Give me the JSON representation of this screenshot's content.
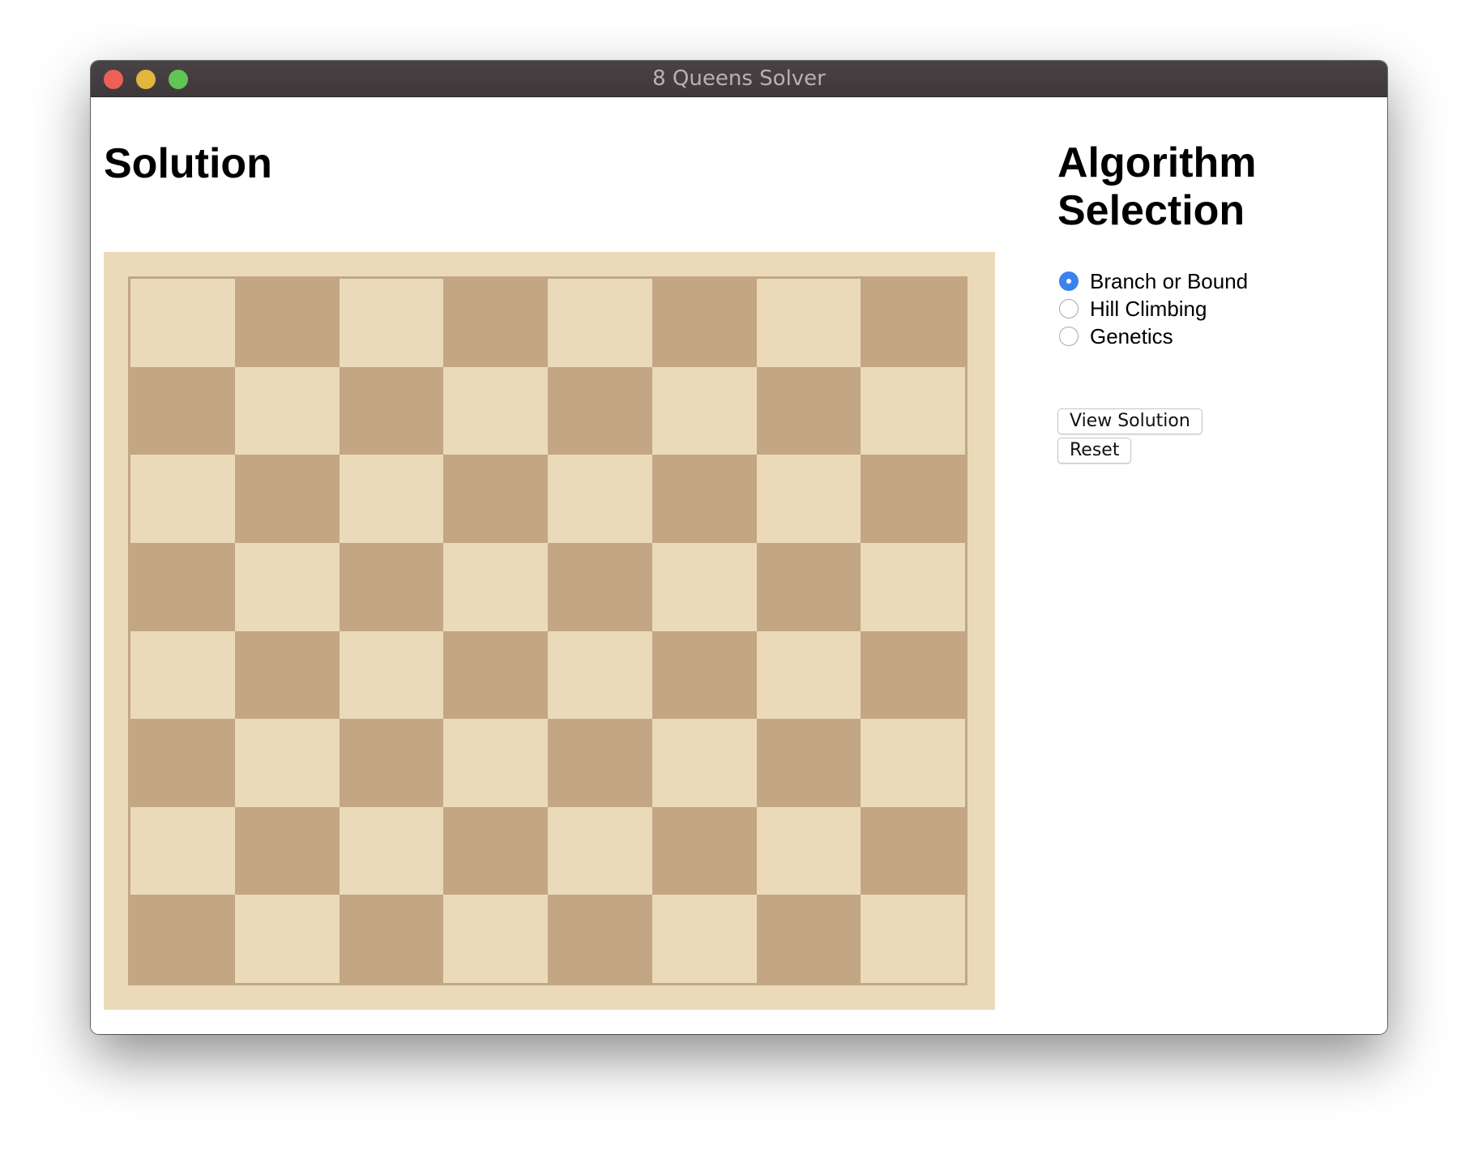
{
  "window": {
    "title": "8 Queens Solver"
  },
  "solution": {
    "heading": "Solution",
    "board": {
      "rows": 8,
      "columns": 8,
      "light_color": "#ebdab9",
      "dark_color": "#c3a683",
      "queens": []
    }
  },
  "algorithm": {
    "heading": "Algorithm Selection",
    "options": [
      {
        "label": "Branch or Bound",
        "selected": true
      },
      {
        "label": "Hill Climbing",
        "selected": false
      },
      {
        "label": "Genetics",
        "selected": false
      }
    ],
    "view_button_label": "View Solution",
    "reset_button_label": "Reset"
  },
  "colors": {
    "accent": "#3b82f0",
    "titlebar": "#453e41"
  }
}
